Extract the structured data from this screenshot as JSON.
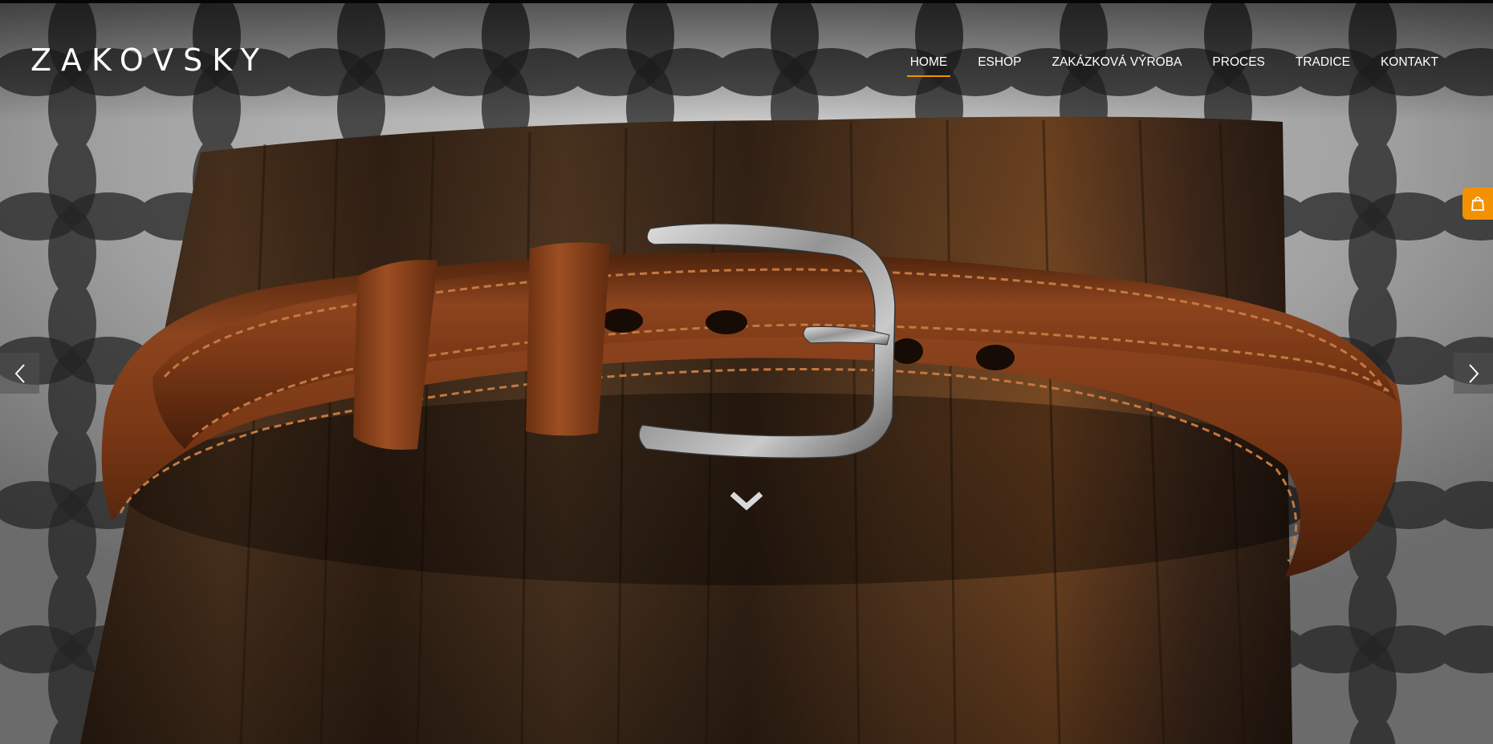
{
  "brand": {
    "logo_text": "ZAKOVSKY"
  },
  "nav": {
    "items": [
      {
        "label": "HOME",
        "active": true
      },
      {
        "label": "ESHOP",
        "active": false
      },
      {
        "label": "ZAKÁZKOVÁ VÝROBA",
        "active": false
      },
      {
        "label": "PROCES",
        "active": false
      },
      {
        "label": "TRADICE",
        "active": false
      },
      {
        "label": "KONTAKT",
        "active": false
      }
    ]
  },
  "slider": {
    "image_subject": "brown leather belt with silver buckle on a weathered wooden block",
    "prev_icon": "chevron-left-icon",
    "next_icon": "chevron-right-icon",
    "scroll_icon": "chevron-down-icon"
  },
  "cart": {
    "icon": "shopping-bag-icon"
  },
  "colors": {
    "accent": "#f39200",
    "nav_text": "#ffffff",
    "leather": "#8a3f18",
    "wood": "#4a3220"
  }
}
